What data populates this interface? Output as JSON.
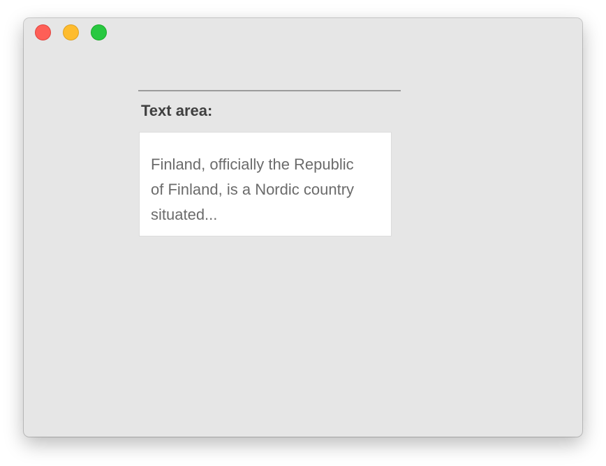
{
  "window": {
    "controls": {
      "close_color": "#fe5f57",
      "minimize_color": "#febc2e",
      "zoom_color": "#28c840"
    }
  },
  "form": {
    "textarea_label": "Text area:",
    "textarea_value": "Finland, officially the Republic\nof Finland, is a Nordic country\nsituated..."
  }
}
